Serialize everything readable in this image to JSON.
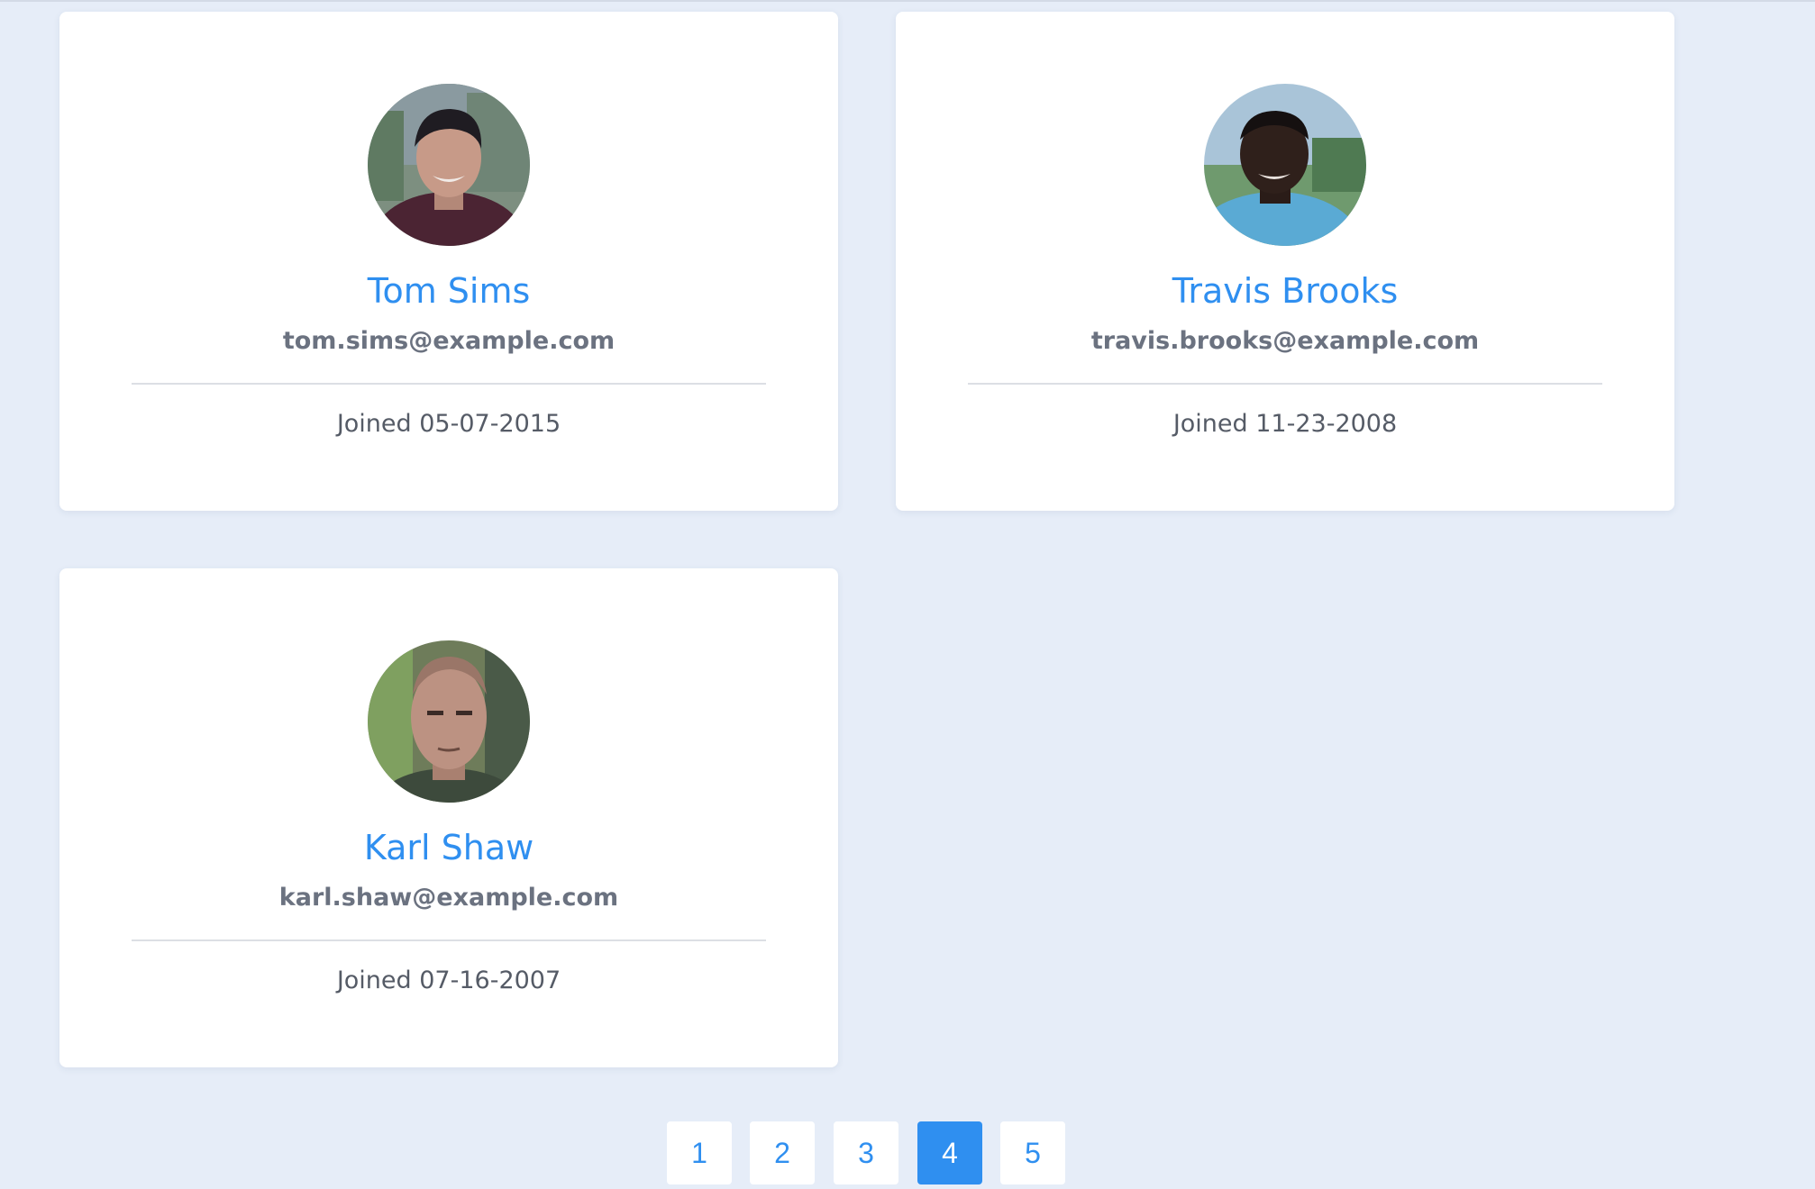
{
  "users": [
    {
      "name": "Tom Sims",
      "email": "tom.sims@example.com",
      "joined": "Joined 05-07-2015"
    },
    {
      "name": "Travis Brooks",
      "email": "travis.brooks@example.com",
      "joined": "Joined 11-23-2008"
    },
    {
      "name": "Karl Shaw",
      "email": "karl.shaw@example.com",
      "joined": "Joined 07-16-2007"
    }
  ],
  "pagination": {
    "pages": [
      "1",
      "2",
      "3",
      "4",
      "5"
    ],
    "current": "4"
  },
  "colors": {
    "background": "#e6edf8",
    "accent": "#2f8ff0",
    "card": "#ffffff",
    "email_text": "#6b7280",
    "joined_text": "#555b66"
  }
}
